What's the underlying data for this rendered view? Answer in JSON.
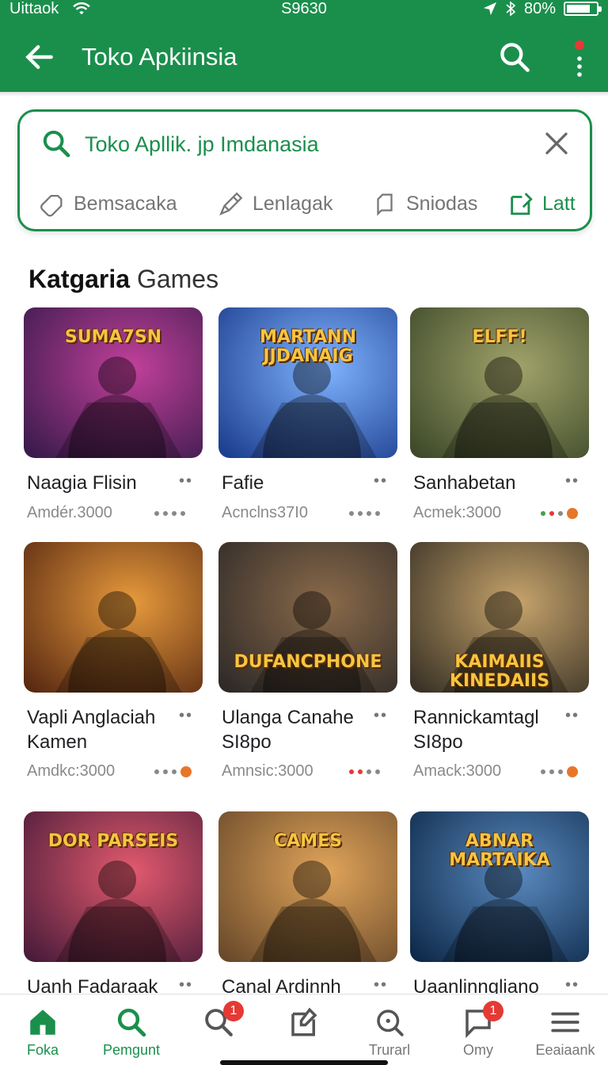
{
  "status_bar": {
    "carrier": "Uittaok",
    "time": "S9630",
    "battery": "80%",
    "battery_level": 0.8
  },
  "app_bar": {
    "title": "Toko Apkiinsia"
  },
  "search": {
    "query": "Toko Apllik. jp Imdanasia",
    "chips": [
      {
        "label": "Bemsacaka",
        "icon": "tag-icon"
      },
      {
        "label": "Lenlagak",
        "icon": "pencil-icon"
      },
      {
        "label": "Sniodas",
        "icon": "bookmark-icon"
      },
      {
        "label": "Latt",
        "icon": "note-icon",
        "active": true
      }
    ]
  },
  "section": {
    "title_bold": "Katgaria",
    "title_light": "Games"
  },
  "games": [
    {
      "name": "Naagia Flisin",
      "meta": "Amdér.3000",
      "rating_dots": [
        "#888888",
        "#888888",
        "#888888",
        "#888888"
      ],
      "art_text": "SUMA7SN",
      "art_colors": [
        "#3a1b4d",
        "#c2409a"
      ]
    },
    {
      "name": "Fafie",
      "meta": "Acnclns37I0",
      "rating_dots": [
        "#888888",
        "#888888",
        "#888888",
        "#888888"
      ],
      "art_text": "MARTANN JJDANAIG",
      "art_colors": [
        "#1d3f8f",
        "#7fb3ff"
      ]
    },
    {
      "name": "Sanhabetan",
      "meta": "Acmek:3000",
      "rating_dots": [
        "#43a047",
        "#e53935",
        "#888888",
        "#e8762a"
      ],
      "art_text": "ELFF!",
      "art_colors": [
        "#3e4a2a",
        "#a1a36a"
      ]
    },
    {
      "name": "Vapli Anglaciah Kamen",
      "meta": "Amdkc:3000",
      "rating_dots": [
        "#888888",
        "#888888",
        "#888888",
        "#e8762a"
      ],
      "art_text": "",
      "art_colors": [
        "#5a2a12",
        "#e79a3c"
      ]
    },
    {
      "name": "Ulanga Canahe SI8po",
      "meta": "Amnsic:3000",
      "rating_dots": [
        "#e53935",
        "#e53935",
        "#888888",
        "#888888"
      ],
      "art_text": "DUFANCPHONE",
      "art_colors": [
        "#2e2a28",
        "#8a6a4a"
      ]
    },
    {
      "name": "Rannickamtagl SI8po",
      "meta": "Amack:3000",
      "rating_dots": [
        "#888888",
        "#888888",
        "#888888",
        "#e8762a"
      ],
      "art_text": "KAIMAIIS KINEDAIIS",
      "art_colors": [
        "#3a3326",
        "#c6a36c"
      ]
    },
    {
      "name": "Uanh Fadaraak",
      "meta": "",
      "rating_dots": [],
      "art_text": "DOR PARSEIS",
      "art_colors": [
        "#4a1c3a",
        "#e35a6e"
      ]
    },
    {
      "name": "Canal Ardinnh",
      "meta": "",
      "rating_dots": [],
      "art_text": "CAMES",
      "art_colors": [
        "#6a4a2a",
        "#e0a45a"
      ]
    },
    {
      "name": "Uaanlinngliano",
      "meta": "",
      "rating_dots": [],
      "art_text": "ABNAR MARTAIKA",
      "art_colors": [
        "#0e2a4a",
        "#5a8ac0"
      ]
    }
  ],
  "bottom_nav": [
    {
      "label": "Foka",
      "icon": "home-icon",
      "active": true,
      "badge": ""
    },
    {
      "label": "Pemgunt",
      "icon": "search-icon",
      "active": true,
      "badge": ""
    },
    {
      "label": "",
      "icon": "search-icon",
      "active": false,
      "badge": "1"
    },
    {
      "label": "",
      "icon": "edit-icon",
      "active": false,
      "badge": ""
    },
    {
      "label": "Trurarl",
      "icon": "search-icon",
      "active": false,
      "badge": ""
    },
    {
      "label": "Omy",
      "icon": "chat-icon",
      "active": false,
      "badge": "1"
    },
    {
      "label": "Eeaiaank",
      "icon": "menu-icon",
      "active": false,
      "badge": ""
    }
  ],
  "colors": {
    "primary": "#1a8f4c",
    "badge": "#e53935",
    "accent_orange": "#e8762a"
  }
}
